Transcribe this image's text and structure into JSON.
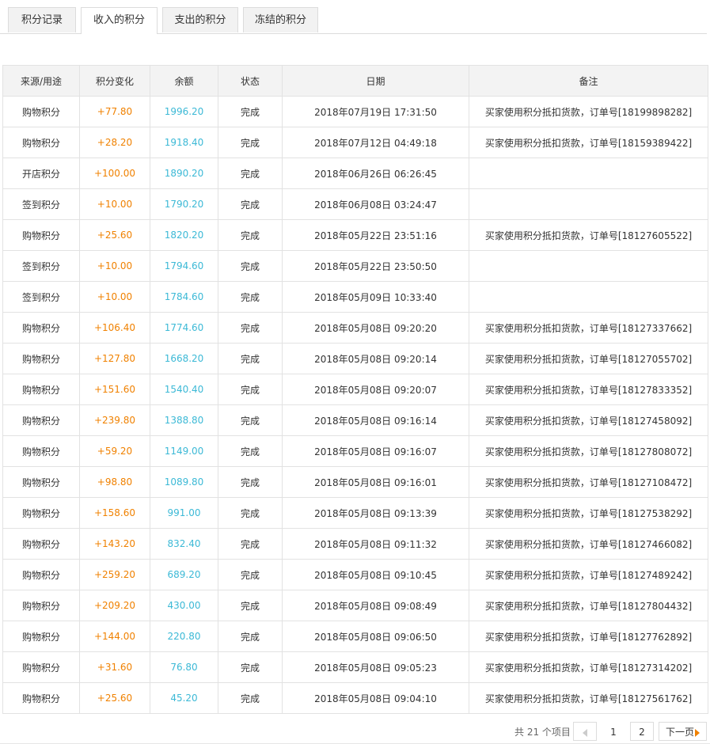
{
  "tabs": [
    {
      "label": "积分记录",
      "active": false
    },
    {
      "label": "收入的积分",
      "active": true
    },
    {
      "label": "支出的积分",
      "active": false
    },
    {
      "label": "冻结的积分",
      "active": false
    }
  ],
  "table": {
    "headers": [
      "来源/用途",
      "积分变化",
      "余额",
      "状态",
      "日期",
      "备注"
    ],
    "rows": [
      [
        "购物积分",
        "+77.80",
        "1996.20",
        "完成",
        "2018年07月19日 17:31:50",
        "买家使用积分抵扣货款，订单号[18199898282]"
      ],
      [
        "购物积分",
        "+28.20",
        "1918.40",
        "完成",
        "2018年07月12日 04:49:18",
        "买家使用积分抵扣货款，订单号[18159389422]"
      ],
      [
        "开店积分",
        "+100.00",
        "1890.20",
        "完成",
        "2018年06月26日 06:26:45",
        ""
      ],
      [
        "签到积分",
        "+10.00",
        "1790.20",
        "完成",
        "2018年06月08日 03:24:47",
        ""
      ],
      [
        "购物积分",
        "+25.60",
        "1820.20",
        "完成",
        "2018年05月22日 23:51:16",
        "买家使用积分抵扣货款，订单号[18127605522]"
      ],
      [
        "签到积分",
        "+10.00",
        "1794.60",
        "完成",
        "2018年05月22日 23:50:50",
        ""
      ],
      [
        "签到积分",
        "+10.00",
        "1784.60",
        "完成",
        "2018年05月09日 10:33:40",
        ""
      ],
      [
        "购物积分",
        "+106.40",
        "1774.60",
        "完成",
        "2018年05月08日 09:20:20",
        "买家使用积分抵扣货款，订单号[18127337662]"
      ],
      [
        "购物积分",
        "+127.80",
        "1668.20",
        "完成",
        "2018年05月08日 09:20:14",
        "买家使用积分抵扣货款，订单号[18127055702]"
      ],
      [
        "购物积分",
        "+151.60",
        "1540.40",
        "完成",
        "2018年05月08日 09:20:07",
        "买家使用积分抵扣货款，订单号[18127833352]"
      ],
      [
        "购物积分",
        "+239.80",
        "1388.80",
        "完成",
        "2018年05月08日 09:16:14",
        "买家使用积分抵扣货款，订单号[18127458092]"
      ],
      [
        "购物积分",
        "+59.20",
        "1149.00",
        "完成",
        "2018年05月08日 09:16:07",
        "买家使用积分抵扣货款，订单号[18127808072]"
      ],
      [
        "购物积分",
        "+98.80",
        "1089.80",
        "完成",
        "2018年05月08日 09:16:01",
        "买家使用积分抵扣货款，订单号[18127108472]"
      ],
      [
        "购物积分",
        "+158.60",
        "991.00",
        "完成",
        "2018年05月08日 09:13:39",
        "买家使用积分抵扣货款，订单号[18127538292]"
      ],
      [
        "购物积分",
        "+143.20",
        "832.40",
        "完成",
        "2018年05月08日 09:11:32",
        "买家使用积分抵扣货款，订单号[18127466082]"
      ],
      [
        "购物积分",
        "+259.20",
        "689.20",
        "完成",
        "2018年05月08日 09:10:45",
        "买家使用积分抵扣货款，订单号[18127489242]"
      ],
      [
        "购物积分",
        "+209.20",
        "430.00",
        "完成",
        "2018年05月08日 09:08:49",
        "买家使用积分抵扣货款，订单号[18127804432]"
      ],
      [
        "购物积分",
        "+144.00",
        "220.80",
        "完成",
        "2018年05月08日 09:06:50",
        "买家使用积分抵扣货款，订单号[18127762892]"
      ],
      [
        "购物积分",
        "+31.60",
        "76.80",
        "完成",
        "2018年05月08日 09:05:23",
        "买家使用积分抵扣货款，订单号[18127314202]"
      ],
      [
        "购物积分",
        "+25.60",
        "45.20",
        "完成",
        "2018年05月08日 09:04:10",
        "买家使用积分抵扣货款，订单号[18127561762]"
      ]
    ]
  },
  "pagination": {
    "total_label": "共 21 个项目",
    "pages": [
      "1",
      "2"
    ],
    "current_page": "1",
    "next_label": "下一页"
  },
  "colors": {
    "change": "#f08100",
    "balance": "#3cb9d6",
    "header_bg": "#f3f3f3",
    "border": "#e2e2e2"
  },
  "icons": {
    "prev": "triangle-left-icon",
    "next": "triangle-right-icon"
  }
}
